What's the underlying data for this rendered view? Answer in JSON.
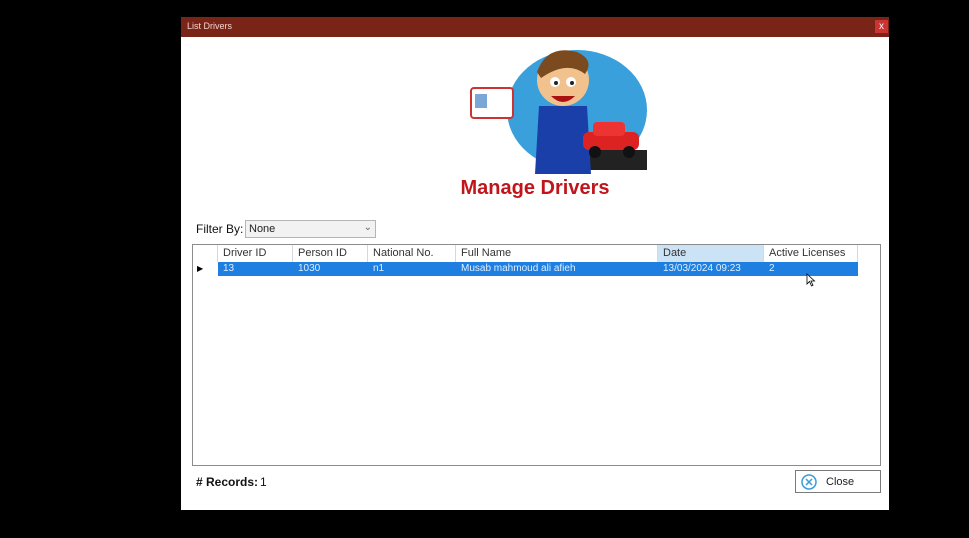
{
  "window": {
    "title": "List Drivers",
    "close_glyph": "x"
  },
  "header": {
    "title": "Manage Drivers",
    "logo_icon": "driver-license-car-icon"
  },
  "filter": {
    "label": "Filter By:",
    "selected": "None"
  },
  "grid": {
    "columns": [
      "Driver ID",
      "Person ID",
      "National No.",
      "Full Name",
      "Date",
      "Active Licenses"
    ],
    "sorted_column": "Date",
    "rows": [
      {
        "driver_id": "13",
        "person_id": "1030",
        "national_no": "n1",
        "full_name": "Musab mahmoud ali afieh",
        "date": "13/03/2024 09:23",
        "active_licenses": "2"
      }
    ]
  },
  "footer": {
    "records_label": "# Records:",
    "records_value": "1",
    "close_label": "Close"
  },
  "colors": {
    "titlebar": "#7a2418",
    "heading": "#c0161b",
    "selection": "#1e7fe0"
  }
}
